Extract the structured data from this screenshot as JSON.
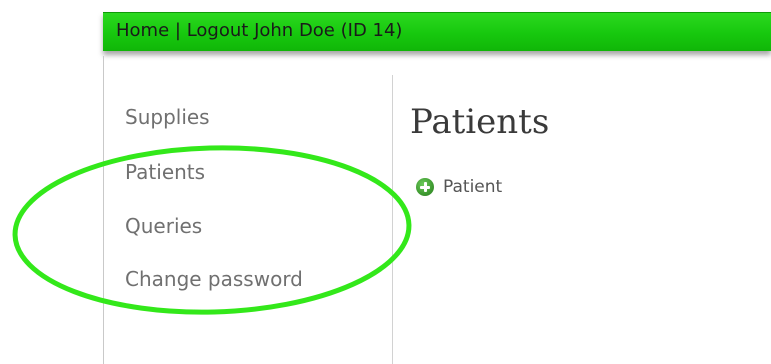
{
  "header": {
    "home_label": "Home",
    "separator": "|",
    "logout_label": "Logout",
    "user_info": "John Doe (ID 14)"
  },
  "sidebar": {
    "items": [
      {
        "label": "Supplies"
      },
      {
        "label": "Patients"
      },
      {
        "label": "Queries"
      },
      {
        "label": "Change password"
      }
    ]
  },
  "main": {
    "title": "Patients",
    "add_label": "Patient"
  },
  "colors": {
    "header_green": "#17c80e",
    "annotation_ellipse": "#33e81a",
    "add_icon": "#3f9a31"
  },
  "icons": {
    "add": "plus-circle-icon"
  }
}
